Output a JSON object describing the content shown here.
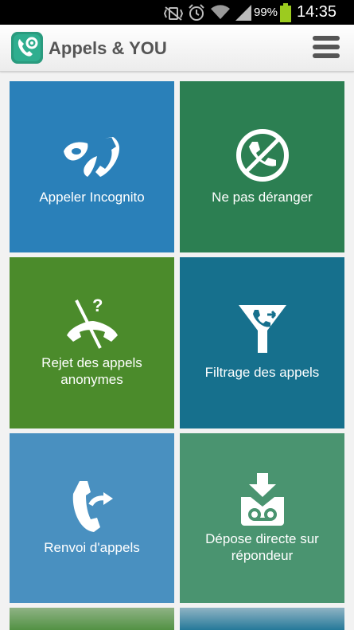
{
  "statusbar": {
    "battery_percent": "99%",
    "time": "14:35",
    "icons": [
      "mute-vibrate-icon",
      "alarm-icon",
      "wifi-icon",
      "signal-icon",
      "battery-icon"
    ]
  },
  "appbar": {
    "title": "Appels & YOU",
    "logo_icon": "phone-gear-icon",
    "menu_icon": "hamburger-menu-icon"
  },
  "tiles": [
    {
      "label": "Appeler Incognito",
      "icon": "mask-phone-icon",
      "color": "#2a80b9"
    },
    {
      "label": "Ne pas déranger",
      "icon": "no-phone-icon",
      "color": "#2c7f52"
    },
    {
      "label": "Rejet des appels anonymes",
      "icon": "phone-slash-question-icon",
      "color": "#4b8b2b"
    },
    {
      "label": "Filtrage des appels",
      "icon": "funnel-phone-icon",
      "color": "#16708d"
    },
    {
      "label": "Renvoi d'appels",
      "icon": "call-forward-icon",
      "color": "#4990c0"
    },
    {
      "label": "Dépose directe sur répondeur",
      "icon": "voicemail-drop-icon",
      "color": "#4a9470"
    }
  ],
  "partial_tiles": [
    {
      "color": "#4e8f3f"
    },
    {
      "color": "#1d7596"
    }
  ]
}
